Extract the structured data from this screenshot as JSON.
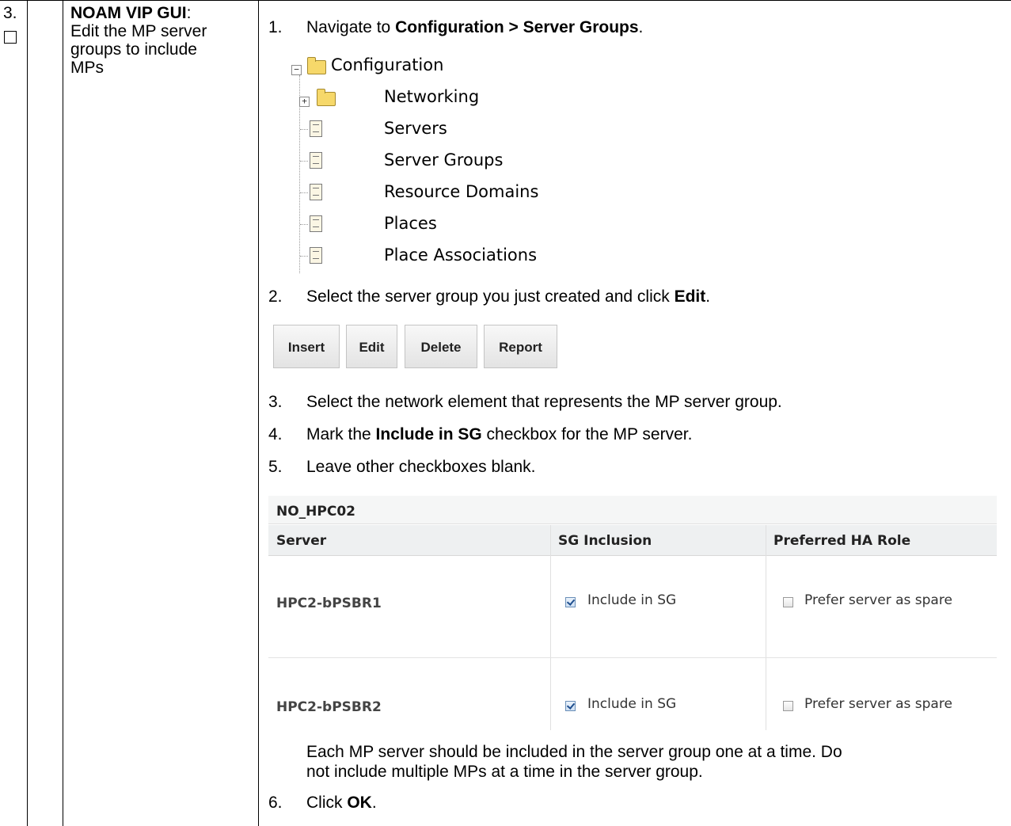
{
  "step_number": "3.",
  "left_cell": {
    "heading": "NOAM VIP GUI",
    "heading_suffix": ":",
    "lines": [
      "Edit the MP server",
      "groups to include",
      "MPs"
    ]
  },
  "steps": [
    {
      "num": "1.",
      "pre": "Navigate to ",
      "bold": "Configuration > Server Groups",
      "post": "."
    },
    {
      "num": "2.",
      "pre": "Select the server group you just created and click ",
      "bold": "Edit",
      "post": "."
    },
    {
      "num": "3.",
      "pre": "Select the network element that represents the MP server group.",
      "bold": "",
      "post": ""
    },
    {
      "num": "4.",
      "pre": "Mark the ",
      "bold": "Include in SG",
      "post": " checkbox for the MP server."
    },
    {
      "num": "5.",
      "pre": "Leave other checkboxes blank.",
      "bold": "",
      "post": ""
    },
    {
      "num": "6.",
      "pre": "Click ",
      "bold": "OK",
      "post": "."
    }
  ],
  "note_lines": [
    "Each MP server should be included in the server group one at a time.  Do",
    "not include multiple MPs at a time in the server group."
  ],
  "tree": {
    "root": {
      "label": "Configuration",
      "expander": "−",
      "icon": "open-folder-icon"
    },
    "children": [
      {
        "label": "Networking",
        "expander": "+",
        "icon": "folder-icon"
      },
      {
        "label": "Servers",
        "icon": "document-icon"
      },
      {
        "label": "Server Groups",
        "icon": "document-icon"
      },
      {
        "label": "Resource Domains",
        "icon": "document-icon"
      },
      {
        "label": "Places",
        "icon": "document-icon"
      },
      {
        "label": "Place Associations",
        "icon": "document-icon"
      }
    ]
  },
  "buttons": [
    "Insert",
    "Edit",
    "Delete",
    "Report"
  ],
  "grid": {
    "title": "NO_HPC02",
    "headers": [
      "Server",
      "SG Inclusion",
      "Preferred HA Role"
    ],
    "rows": [
      {
        "server": "HPC2-bPSBR1",
        "inclusion_label": "Include in SG",
        "inclusion_checked": true,
        "role_label": "Prefer server as spare",
        "role_checked": false
      },
      {
        "server": "HPC2-bPSBR2",
        "inclusion_label": "Include in SG",
        "inclusion_checked": true,
        "role_label": "Prefer server as spare",
        "role_checked": false
      }
    ]
  }
}
